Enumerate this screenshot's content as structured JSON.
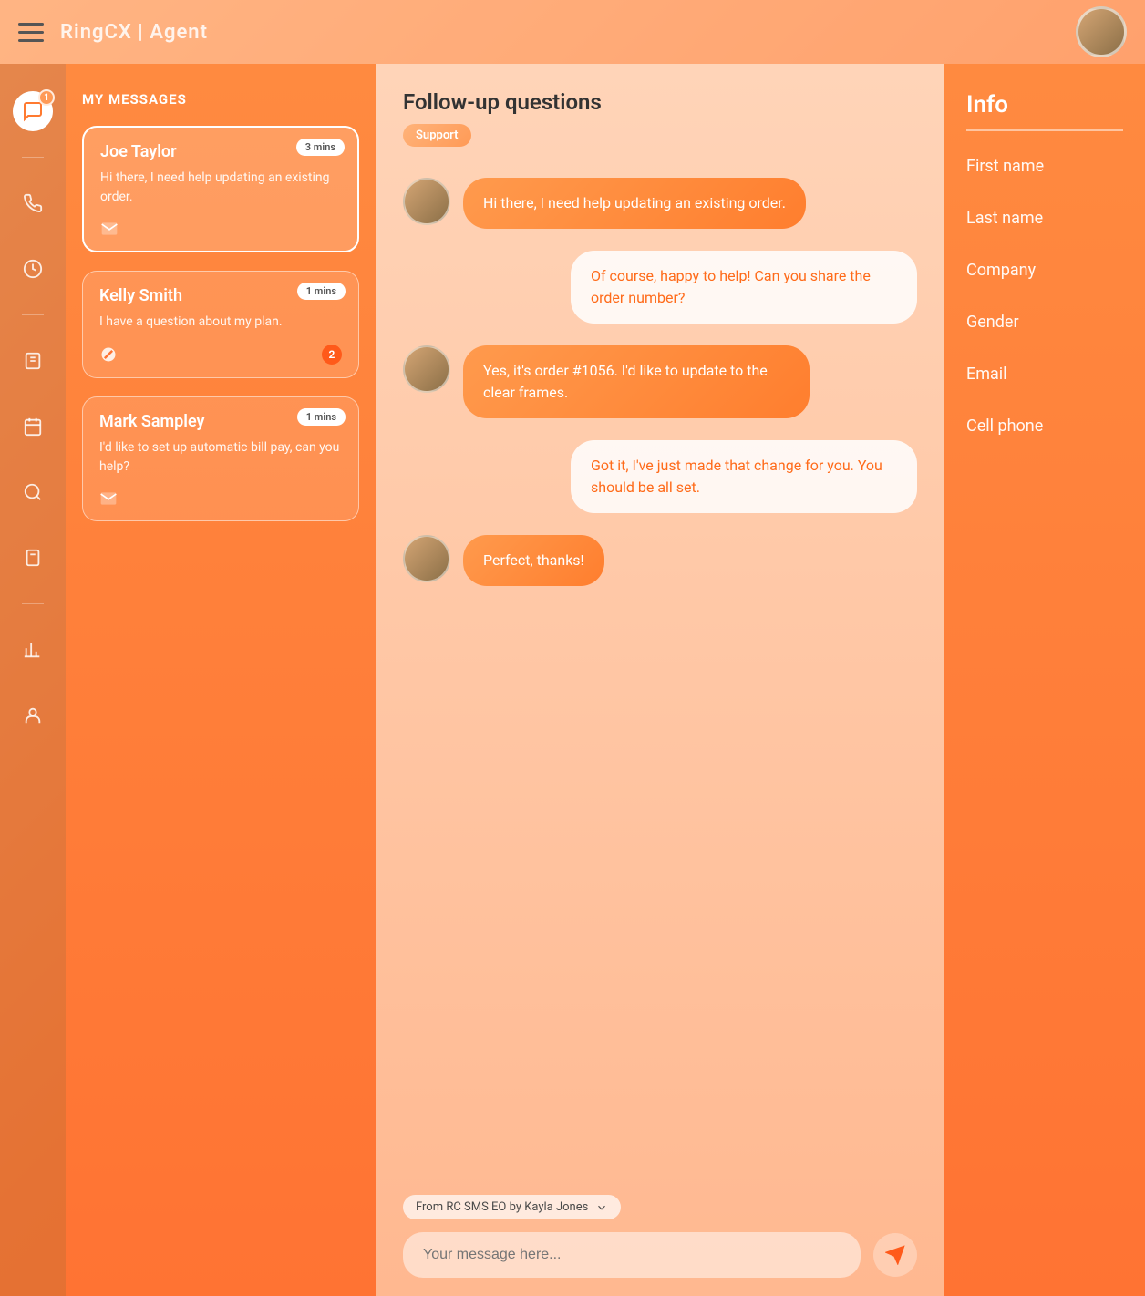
{
  "header": {
    "title": "RingCX | Agent"
  },
  "nav": {
    "badge": "1"
  },
  "sidebar": {
    "title": "MY MESSAGES",
    "conversations": [
      {
        "name": "Joe Taylor",
        "preview": "Hi there, I need help updating an existing order.",
        "time": "3 mins",
        "icon": "envelope",
        "selected": true
      },
      {
        "name": "Kelly Smith",
        "preview": "I have a question about my plan.",
        "time": "1 mins",
        "icon": "blocked",
        "count": "2"
      },
      {
        "name": "Mark Sampley",
        "preview": "I'd like to set up automatic bill pay, can you help?",
        "time": "1 mins",
        "icon": "envelope"
      }
    ]
  },
  "chat": {
    "title": "Follow-up questions",
    "tag": "Support",
    "messages": [
      {
        "side": "incoming",
        "text": "Hi there, I need help updating an existing order."
      },
      {
        "side": "outgoing",
        "text": "Of course, happy to help! Can you share the order number?"
      },
      {
        "side": "incoming",
        "text": "Yes, it's order #1056. I'd like to update to the clear frames."
      },
      {
        "side": "outgoing",
        "text": "Got it, I've just made that change for you. You should be all set."
      },
      {
        "side": "incoming",
        "text": "Perfect, thanks!"
      }
    ],
    "from": "From RC SMS EO by Kayla Jones",
    "placeholder": "Your message here..."
  },
  "info": {
    "title": "Info",
    "fields": [
      "First name",
      "Last name",
      "Company",
      "Gender",
      "Email",
      "Cell phone"
    ]
  }
}
